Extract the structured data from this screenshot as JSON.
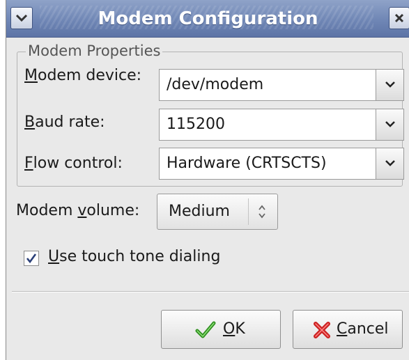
{
  "window": {
    "title": "Modem Configuration"
  },
  "frame": {
    "legend": "Modem Properties"
  },
  "fields": {
    "device": {
      "label_mnemonic": "M",
      "label_rest": "odem device:",
      "value": "/dev/modem"
    },
    "baud": {
      "label_mnemonic": "B",
      "label_rest": "aud rate:",
      "value": "115200"
    },
    "flow": {
      "label_mnemonic": "F",
      "label_rest": "low control:",
      "value": "Hardware (CRTSCTS)"
    }
  },
  "volume": {
    "label_pre": "Modem ",
    "label_mnemonic": "v",
    "label_rest": "olume:",
    "value": "Medium"
  },
  "touch_tone": {
    "checked": true,
    "label_mnemonic": "U",
    "label_rest": "se touch tone dialing"
  },
  "buttons": {
    "ok": {
      "mnemonic": "O",
      "rest": "K"
    },
    "cancel": {
      "mnemonic": "C",
      "rest": "ancel"
    }
  },
  "icons": {
    "menu": "chevron-down-icon",
    "close": "close-icon",
    "ok": "checkmark-icon",
    "cancel": "cancel-x-icon"
  },
  "colors": {
    "titlebar": "#6f86b5",
    "ok_icon": "#2f8f1f",
    "cancel_icon": "#cc2222"
  }
}
